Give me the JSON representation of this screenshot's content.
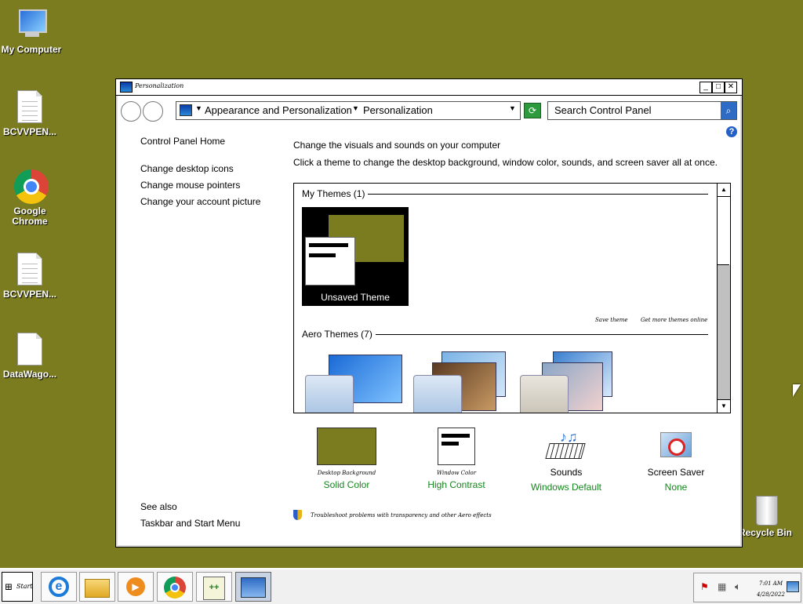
{
  "desktop": {
    "icons": [
      {
        "label": "My Computer"
      },
      {
        "label": "BCVVPEN..."
      },
      {
        "label": "Google Chrome"
      },
      {
        "label": "BCVVPEN..."
      },
      {
        "label": "DataWago..."
      },
      {
        "label": "Recycle Bin"
      }
    ],
    "background_color": "#7b7c1f"
  },
  "window": {
    "title": "Personalization",
    "breadcrumb": [
      "Appearance and Personalization",
      "Personalization"
    ],
    "search_placeholder": "Search Control Panel",
    "help_label": "?",
    "sidebar": {
      "home": "Control Panel Home",
      "links": [
        "Change desktop icons",
        "Change mouse pointers",
        "Change your account picture"
      ],
      "see_also_header": "See also",
      "see_also_links": [
        "Taskbar and Start Menu"
      ]
    },
    "main": {
      "heading": "Change the visuals and sounds on your computer",
      "description": "Click a theme to change the desktop background, window color, sounds, and screen saver all at once.",
      "my_themes_header": "My Themes (1)",
      "unsaved_theme_label": "Unsaved Theme",
      "save_theme": "Save theme",
      "get_more_themes": "Get more themes online",
      "aero_themes_header": "Aero Themes (7)"
    },
    "settings": [
      {
        "caption": "Desktop Background",
        "value": "Solid Color",
        "icon": "solid-color-swatch",
        "swatch_color": "#7b7c1f"
      },
      {
        "caption": "Window Color",
        "value": "High Contrast",
        "icon": "window-color-icon"
      },
      {
        "caption": "Sounds",
        "value": "Windows Default",
        "icon": "sounds-icon"
      },
      {
        "caption": "Screen Saver",
        "value": "None",
        "icon": "screen-saver-icon"
      }
    ],
    "troubleshoot": "Troubleshoot problems with transparency and other Aero effects"
  },
  "taskbar": {
    "start_label": "Start",
    "apps": [
      "internet-explorer-icon",
      "file-explorer-icon",
      "media-player-icon",
      "chrome-icon",
      "notepad-plus-plus-icon",
      "control-panel-icon"
    ],
    "clock_time": "7:01 AM",
    "clock_date": "4/28/2022"
  }
}
